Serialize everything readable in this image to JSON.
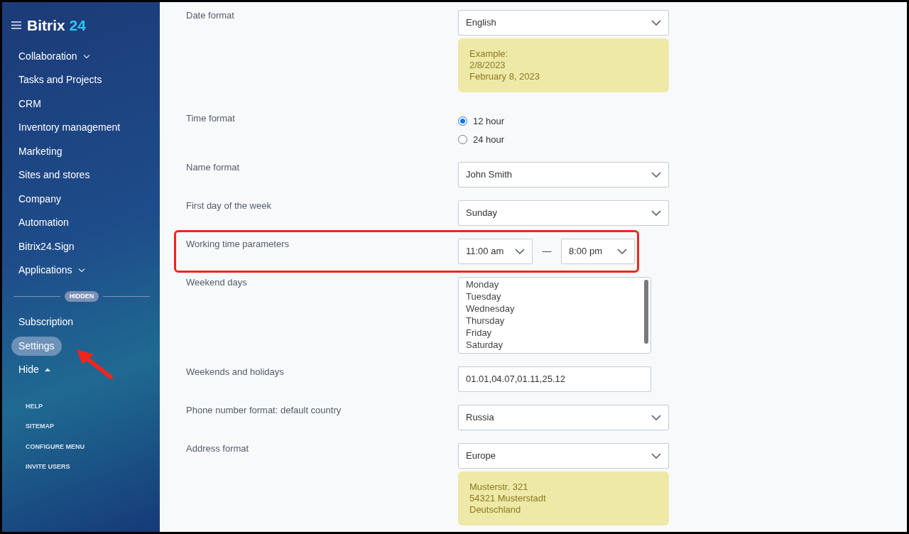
{
  "sidebar": {
    "logo": {
      "name": "Bitrix",
      "number": "24"
    },
    "items": [
      {
        "label": "Collaboration",
        "has_submenu": true,
        "submenu_open": false,
        "selected": false
      },
      {
        "label": "Tasks and Projects",
        "has_submenu": false,
        "submenu_open": false,
        "selected": false
      },
      {
        "label": "CRM",
        "has_submenu": false,
        "submenu_open": false,
        "selected": false
      },
      {
        "label": "Inventory management",
        "has_submenu": false,
        "submenu_open": false,
        "selected": false
      },
      {
        "label": "Marketing",
        "has_submenu": false,
        "submenu_open": false,
        "selected": false
      },
      {
        "label": "Sites and stores",
        "has_submenu": false,
        "submenu_open": false,
        "selected": false
      },
      {
        "label": "Company",
        "has_submenu": false,
        "submenu_open": false,
        "selected": false
      },
      {
        "label": "Automation",
        "has_submenu": false,
        "submenu_open": false,
        "selected": false
      },
      {
        "label": "Bitrix24.Sign",
        "has_submenu": false,
        "submenu_open": false,
        "selected": false
      },
      {
        "label": "Applications",
        "has_submenu": true,
        "submenu_open": false,
        "selected": false
      }
    ],
    "divider_label": "HIDDEN",
    "hidden_items": [
      {
        "label": "Subscription",
        "has_submenu": false,
        "submenu_open": false,
        "selected": false
      },
      {
        "label": "Settings",
        "has_submenu": false,
        "submenu_open": false,
        "selected": true
      },
      {
        "label": "Hide",
        "has_submenu": true,
        "submenu_open": true,
        "selected": false
      }
    ],
    "footer_links": [
      "HELP",
      "SITEMAP",
      "CONFIGURE MENU",
      "INVITE USERS"
    ]
  },
  "settings": [
    {
      "kind": "select",
      "label": "Date format",
      "value": "English",
      "note": [
        "Example:",
        "2/8/2023",
        "February 8, 2023"
      ],
      "highlighted": false
    },
    {
      "kind": "radio",
      "label": "Time format",
      "options": [
        {
          "label": "12 hour",
          "selected": true
        },
        {
          "label": "24 hour",
          "selected": false
        }
      ],
      "highlighted": false
    },
    {
      "kind": "select",
      "label": "Name format",
      "value": "John Smith",
      "highlighted": false
    },
    {
      "kind": "select",
      "label": "First day of the week",
      "value": "Sunday",
      "highlighted": false
    },
    {
      "kind": "range",
      "label": "Working time parameters",
      "from": "11:00 am",
      "separator": "—",
      "to": "8:00 pm",
      "highlighted": true
    },
    {
      "kind": "list",
      "label": "Weekend days",
      "options": [
        {
          "label": "Monday",
          "selected": false
        },
        {
          "label": "Tuesday",
          "selected": false
        },
        {
          "label": "Wednesday",
          "selected": false
        },
        {
          "label": "Thursday",
          "selected": false
        },
        {
          "label": "Friday",
          "selected": false
        },
        {
          "label": "Saturday",
          "selected": false
        }
      ],
      "highlighted": false
    },
    {
      "kind": "text",
      "label": "Weekends and holidays",
      "value": "01.01,04.07,01.11,25.12",
      "highlighted": false
    },
    {
      "kind": "select",
      "label": "Phone number format: default country",
      "value": "Russia",
      "highlighted": false
    },
    {
      "kind": "select",
      "label": "Address format",
      "value": "Europe",
      "note": [
        "Musterstr. 321",
        "54321 Musterstadt",
        "Deutschland"
      ],
      "highlighted": false
    }
  ]
}
